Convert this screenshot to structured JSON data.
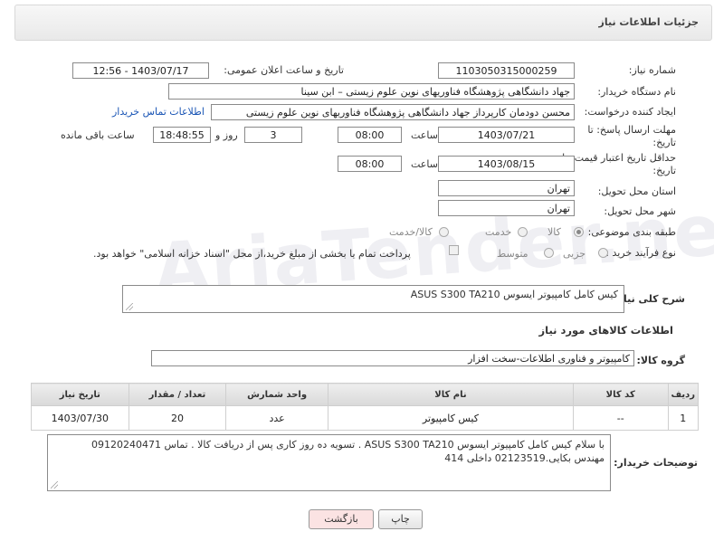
{
  "header": {
    "title": "جزئیات اطلاعات نیاز"
  },
  "form": {
    "need_number": {
      "label": "شماره نیاز:",
      "value": "1103050315000259"
    },
    "announce_datetime": {
      "label": "تاریخ و ساعت اعلان عمومی:",
      "value": "1403/07/17 - 12:56"
    },
    "buyer_org": {
      "label": "نام دستگاه خریدار:",
      "value": "جهاد دانشگاهی پژوهشگاه فناوریهای نوین علوم زیستی – ابن سینا"
    },
    "requester": {
      "label": "ایجاد کننده درخواست:",
      "value": "محسن دودمان کارپرداز جهاد دانشگاهی پژوهشگاه فناوریهای نوین علوم زیستی",
      "contact_link": "اطلاعات تماس خریدار"
    },
    "reply_deadline": {
      "label_line1": "مهلت ارسال پاسخ: تا",
      "label_line2": "تاریخ:",
      "date": "1403/07/21",
      "time_label": "ساعت",
      "time": "08:00",
      "days": "3",
      "days_label": "روز و",
      "remaining": "18:48:55",
      "remaining_label": "ساعت باقی مانده"
    },
    "price_validity": {
      "label_line1": "حداقل تاریخ اعتبار قیمت: تا",
      "label_line2": "تاریخ:",
      "date": "1403/08/15",
      "time_label": "ساعت",
      "time": "08:00"
    },
    "delivery_province": {
      "label": "استان محل تحویل:",
      "value": "تهران"
    },
    "delivery_city": {
      "label": "شهر محل تحویل:",
      "value": "تهران"
    },
    "category": {
      "label": "طبقه بندی موضوعی:",
      "options": [
        "کالا",
        "خدمت",
        "کالا/خدمت"
      ],
      "selected": "کالا"
    },
    "purchase_type": {
      "label": "نوع فرآیند خرید :",
      "options": [
        "جزیی",
        "متوسط"
      ],
      "payment_note": "پرداخت تمام یا بخشی از مبلغ خرید،از محل \"اسناد خزانه اسلامی\" خواهد بود."
    }
  },
  "summary": {
    "label": "شرح کلی نیاز:",
    "value": "کیس کامل کامپیوتر ایسوس  ASUS  S300  TA210"
  },
  "goods_section": {
    "title": "اطلاعات کالاهای مورد نیاز"
  },
  "goods_group": {
    "label": "گروه کالا:",
    "value": "کامپیوتر و فناوری اطلاعات-سخت افزار"
  },
  "table": {
    "headers": [
      "ردیف",
      "کد کالا",
      "نام کالا",
      "واحد شمارش",
      "تعداد / مقدار",
      "تاریخ نیاز"
    ],
    "rows": [
      [
        "1",
        "--",
        "کیس کامپیوتر",
        "عدد",
        "20",
        "1403/07/30"
      ]
    ]
  },
  "buyer_notes": {
    "label": "توضیحات خریدار:",
    "line1": "با سلام کیس کامل کامپیوتر ایسوس  ASUS  S300  TA210 . تسویه ده روز کاری پس از دریافت کالا . تماس 09120240471",
    "line2": "مهندس بکایی.02123519 داخلی 414"
  },
  "buttons": {
    "print": "چاپ",
    "back": "بازگشت"
  },
  "watermark": "AriaTender.neT",
  "colors": {
    "link": "#1a55b5",
    "back_button_bg": "#fbe3e3"
  }
}
